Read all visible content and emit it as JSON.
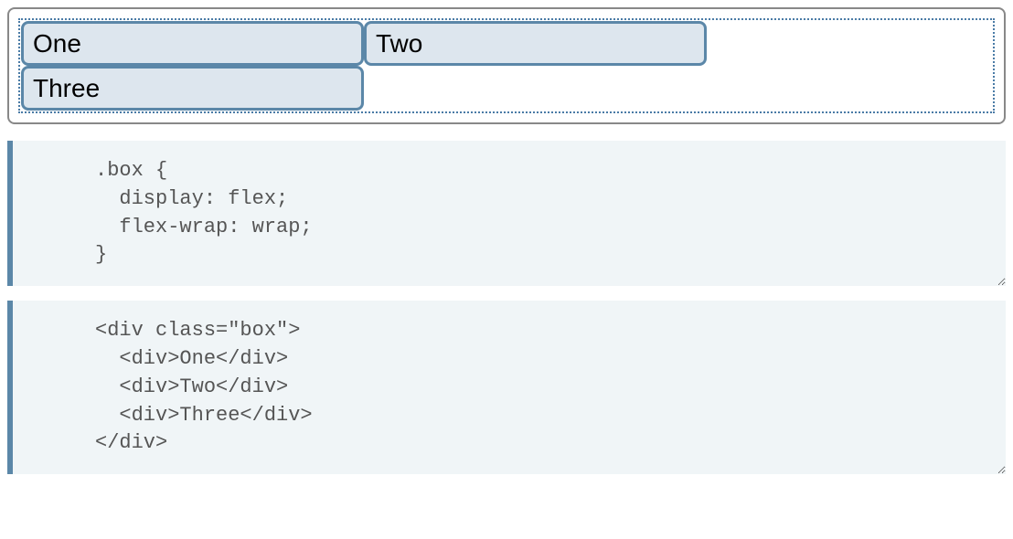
{
  "demo": {
    "items": [
      "One",
      "Two",
      "Three"
    ]
  },
  "code": {
    "css": ".box {\n  display: flex;\n  flex-wrap: wrap;\n}",
    "html": "<div class=\"box\">\n  <div>One</div>\n  <div>Two</div>\n  <div>Three</div>\n</div>"
  }
}
